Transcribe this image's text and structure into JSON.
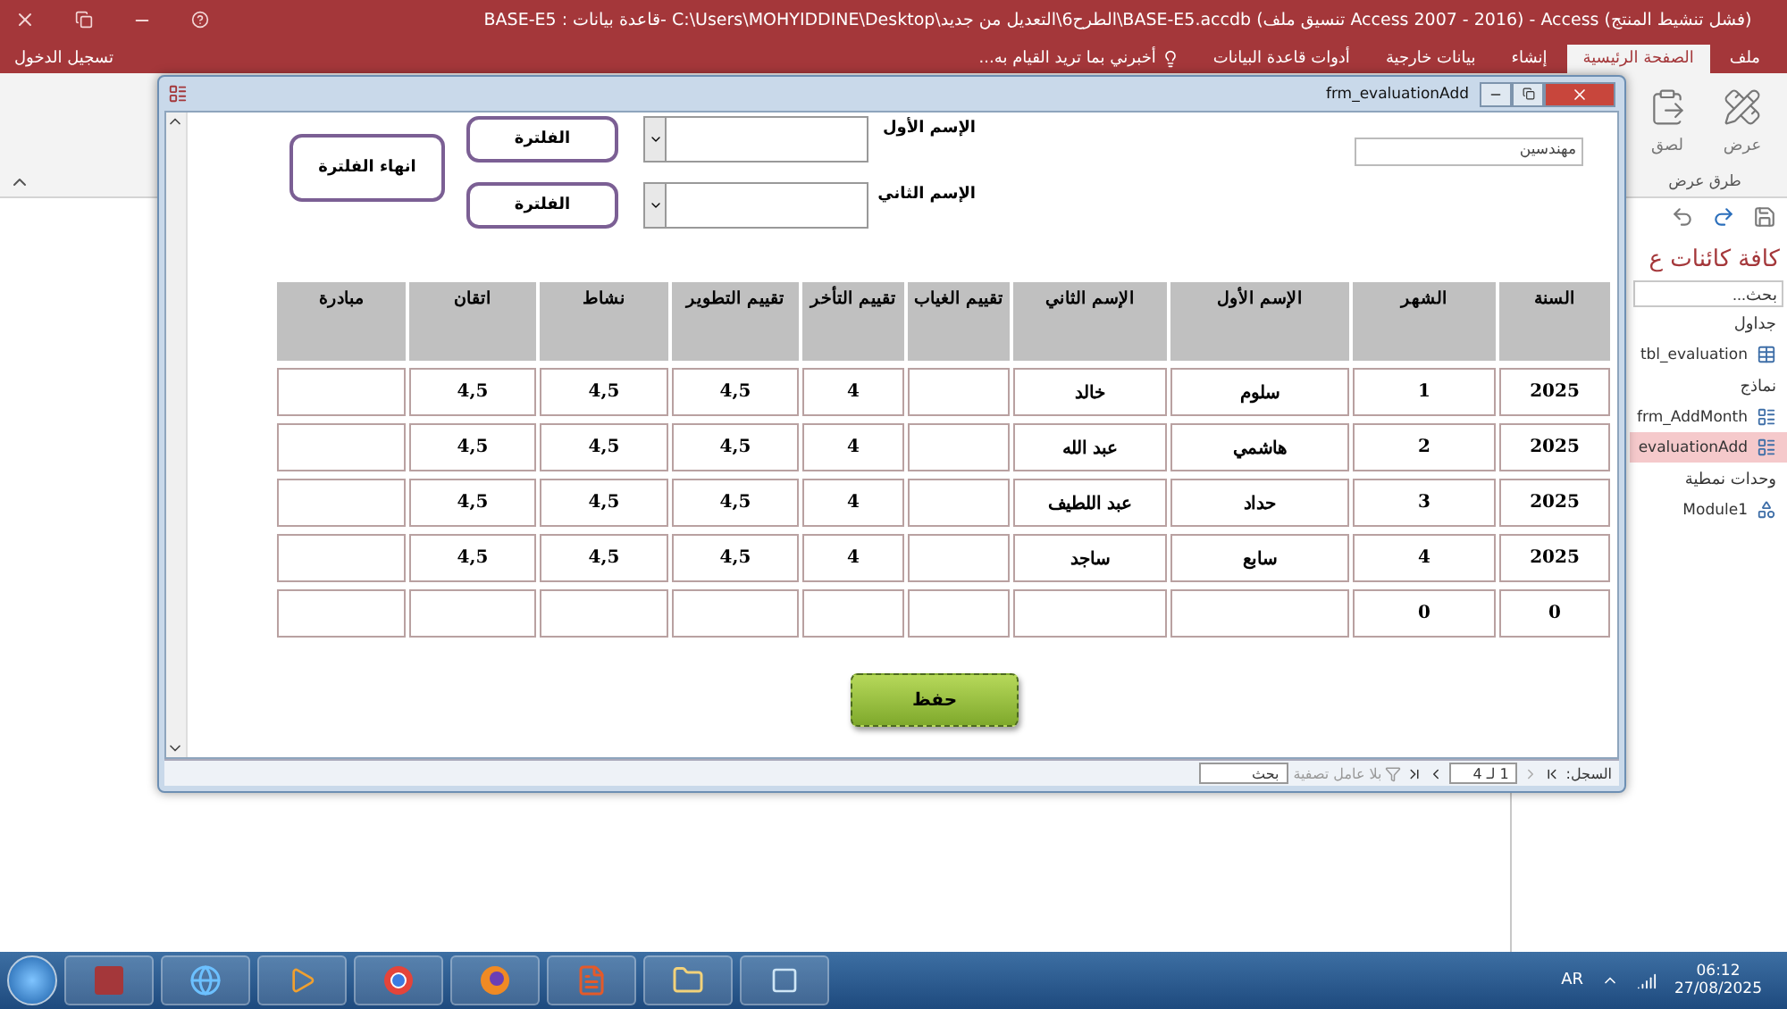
{
  "window": {
    "title": "BASE-E5 : قاعدة بيانات- C:\\Users\\MOHYIDDINE\\Desktop\\الطرح6\\التعديل من جديد\\BASE-E5.accdb (تنسيق ملف Access 2007 - 2016) - Access (فشل تنشيط المنتج)"
  },
  "ribbon_tabs": [
    {
      "label": "ملف",
      "selected": false
    },
    {
      "label": "الصفحة الرئيسية",
      "selected": true
    },
    {
      "label": "إنشاء",
      "selected": false
    },
    {
      "label": "بيانات خارجية",
      "selected": false
    },
    {
      "label": "أدوات قاعدة البيانات",
      "selected": false
    }
  ],
  "tell_me": {
    "placeholder": "أخبرني بما تريد القيام به..."
  },
  "sign_in": "تسجيل الدخول",
  "ribbon": {
    "commands": [
      {
        "label": "عرض",
        "kind": "view"
      },
      {
        "label": "لصق",
        "kind": "paste"
      }
    ],
    "group_label": "طرق عرض"
  },
  "nav_pane": {
    "title": "كافة كائنات ع",
    "search": {
      "placeholder": "بحث..."
    },
    "groups": [
      {
        "heading": "جداول",
        "items": [
          {
            "label": "tbl_evaluation",
            "kind": "table",
            "selected": false
          }
        ]
      },
      {
        "heading": "نماذج",
        "items": [
          {
            "label": "frm_AddMonth",
            "kind": "form",
            "selected": false
          },
          {
            "label": "evaluationAdd",
            "kind": "form",
            "selected": true
          }
        ]
      },
      {
        "heading": "وحدات نمطية",
        "items": [
          {
            "label": "Module1",
            "kind": "module",
            "selected": false
          }
        ]
      }
    ]
  },
  "form": {
    "title": "frm_evaluationAdd",
    "department": "مهندسين",
    "filters": [
      {
        "label": "الإسم الأول",
        "button": "الفلترة"
      },
      {
        "label": "الإسم الثاني",
        "button": "الفلترة"
      }
    ],
    "end_filter": "انهاء الفلترة",
    "table": {
      "columns": [
        "السنة",
        "الشهر",
        "الإسم الأول",
        "الإسم الثاني",
        "تقييم الغياب",
        "تقييم التأخر",
        "تقييم التطوير",
        "نشاط",
        "اتقان",
        "مبادرة"
      ],
      "rows": [
        [
          "2025",
          "1",
          "سلوم",
          "خالد",
          null,
          "4",
          "4,5",
          "4,5",
          "4,5",
          null
        ],
        [
          "2025",
          "2",
          "هاشمي",
          "عبد الله",
          null,
          "4",
          "4,5",
          "4,5",
          "4,5",
          null
        ],
        [
          "2025",
          "3",
          "حداد",
          "عبد اللطيف",
          null,
          "4",
          "4,5",
          "4,5",
          "4,5",
          null
        ],
        [
          "2025",
          "4",
          "سابع",
          "ساجد",
          null,
          "4",
          "4,5",
          "4,5",
          "4,5",
          null
        ],
        [
          "0",
          "0",
          null,
          null,
          null,
          null,
          null,
          null,
          null,
          null
        ]
      ]
    },
    "save_button": "حفظ",
    "record_bar": {
      "label": "السجل:",
      "position": "1 لـ 4",
      "filter": "بلا عامل تصفية",
      "search": "بحث"
    }
  },
  "taskbar": {
    "language": "AR",
    "time": "06:12",
    "date": "27/08/2025"
  }
}
